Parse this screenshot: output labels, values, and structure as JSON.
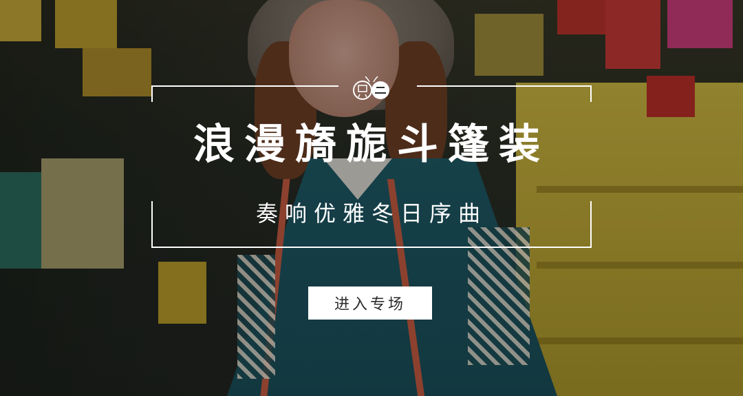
{
  "banner": {
    "title": "浪漫旖旎斗篷装",
    "subtitle": "奏响优雅冬日序曲",
    "cta_label": "进入专场",
    "logo_icon": "bee-logo-icon"
  },
  "colors": {
    "text": "#ffffff",
    "button_bg": "#ffffff",
    "button_text": "#2b2b2b",
    "wall_yellow": "#c9b441",
    "poncho_teal": "#1f5a66",
    "accent_red": "#c25a40"
  }
}
